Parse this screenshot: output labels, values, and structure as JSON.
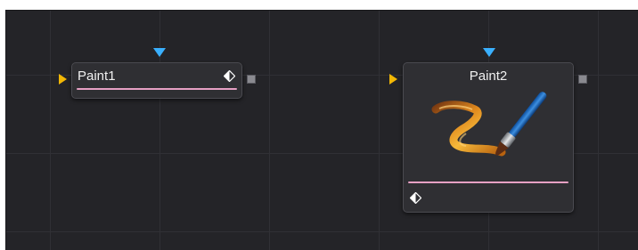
{
  "nodes": [
    {
      "title": "Paint1"
    },
    {
      "title": "Paint2"
    }
  ],
  "colors": {
    "canvas_background": "#242428",
    "grid_line": "#303035",
    "node_background": "#2f2f33",
    "node_border": "#4a4a50",
    "input_arrow": "#f2b705",
    "mask_arrow": "#3ab0ff",
    "output_square": "#8a8a90",
    "status_bar": "#e6a0c4"
  },
  "icons": {
    "view_toggle": "diamond-half-icon",
    "paint_tool": "paintbrush-stroke-icon"
  }
}
